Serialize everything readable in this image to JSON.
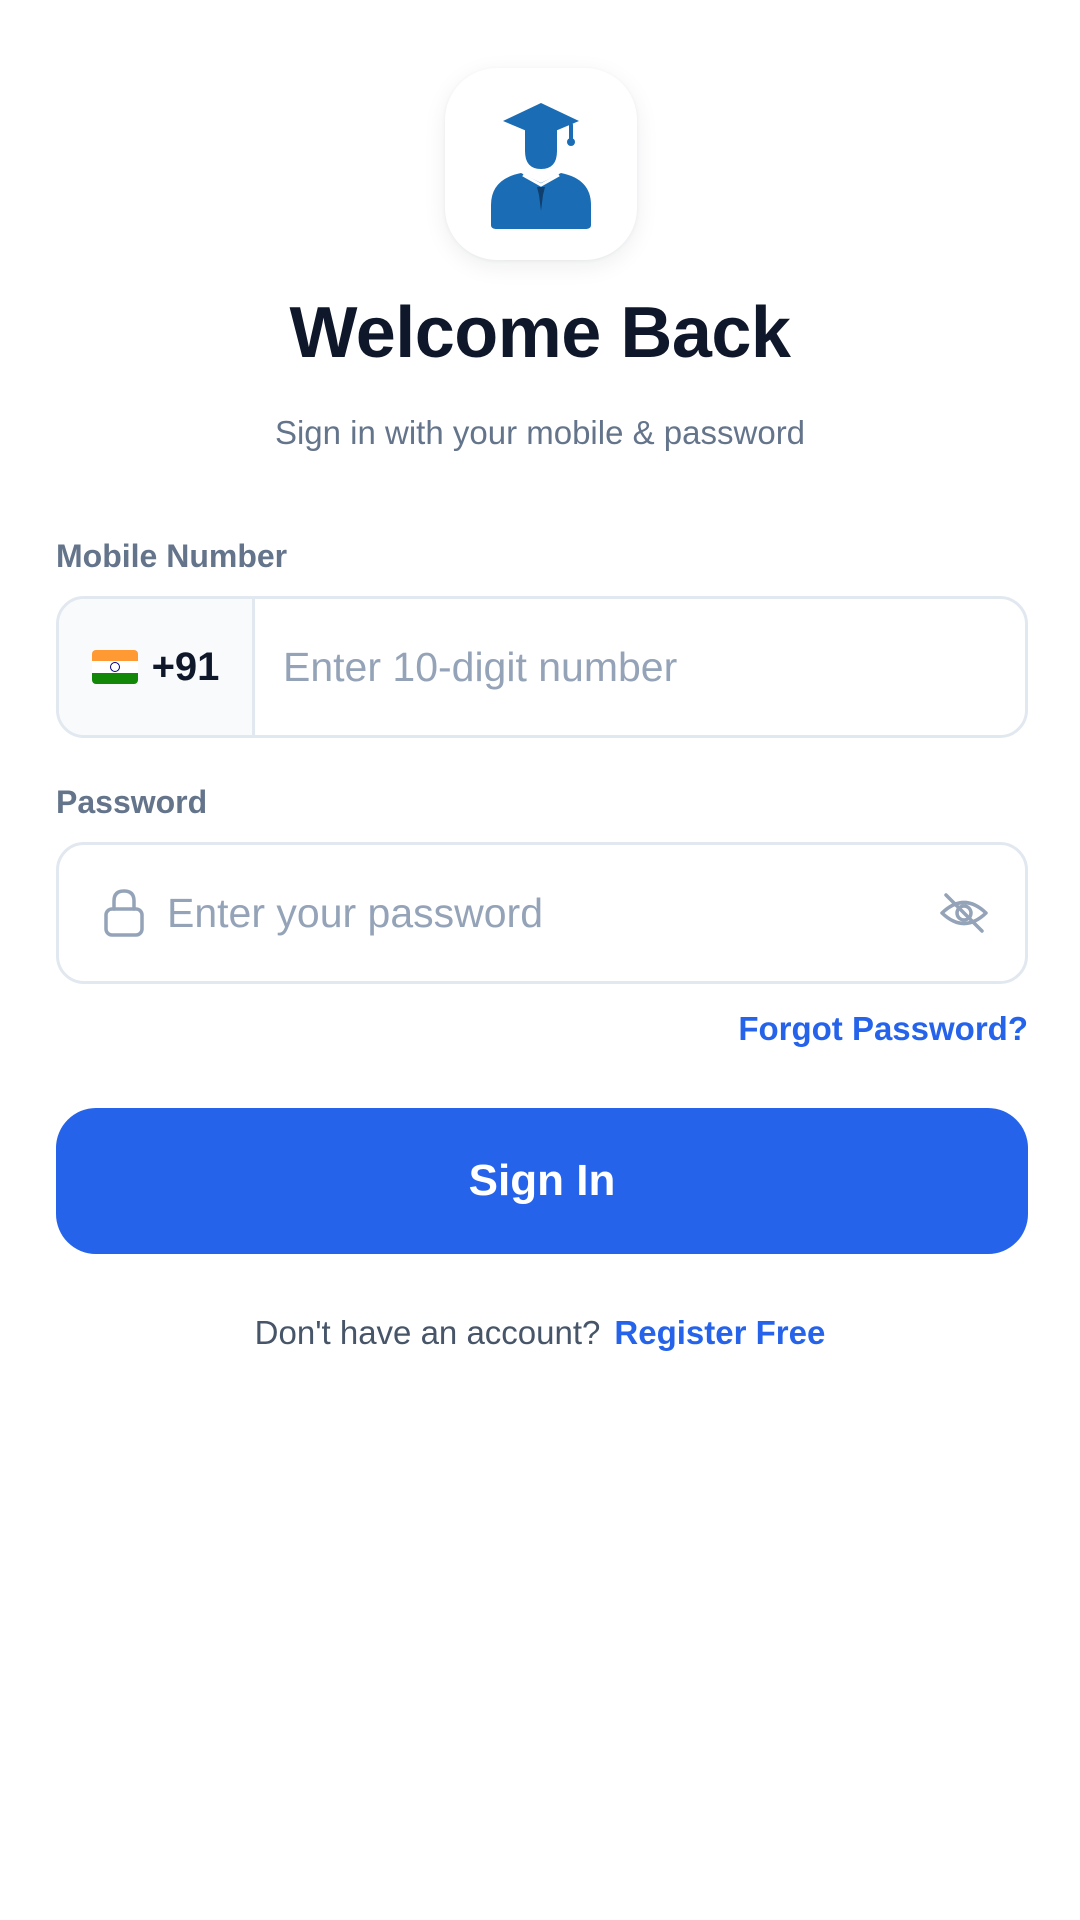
{
  "header": {
    "title": "Welcome Back",
    "subtitle": "Sign in with your mobile & password"
  },
  "logo": {
    "icon": "graduate-student-icon",
    "color": "#1a6db5"
  },
  "mobile": {
    "label": "Mobile Number",
    "country_flag": "india-flag-icon",
    "country_code": "+91",
    "placeholder": "Enter 10-digit number",
    "value": ""
  },
  "password": {
    "label": "Password",
    "placeholder": "Enter your password",
    "value": "",
    "lock_icon": "lock-icon",
    "visibility_icon": "eye-off-icon"
  },
  "links": {
    "forgot_password": "Forgot Password?"
  },
  "actions": {
    "sign_in_label": "Sign In"
  },
  "register": {
    "prompt": "Don't have an account?",
    "link": "Register Free"
  },
  "colors": {
    "primary": "#2563eb",
    "title": "#0f172a",
    "muted": "#64748b",
    "border": "#e2e8f0",
    "placeholder": "#94a3b8"
  }
}
